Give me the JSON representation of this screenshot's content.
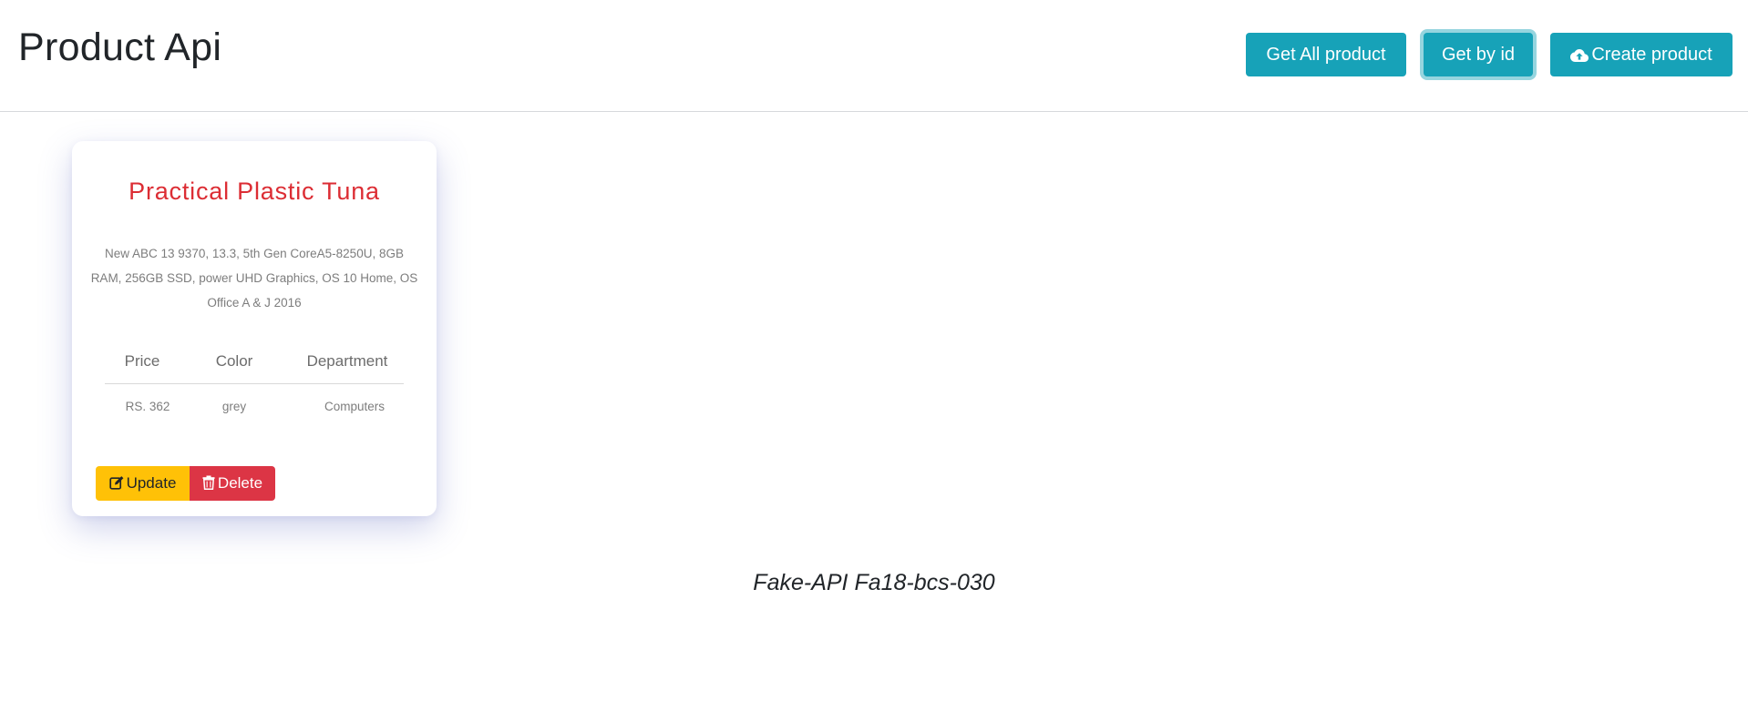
{
  "header": {
    "title": "Product Api",
    "buttons": {
      "get_all": "Get All product",
      "get_by_id": "Get by id",
      "create": "Create product"
    }
  },
  "product": {
    "name": "Practical Plastic Tuna",
    "description": "New ABC 13 9370, 13.3, 5th Gen CoreA5-8250U, 8GB RAM, 256GB SSD, power UHD Graphics, OS 10 Home, OS Office A & J 2016",
    "table": {
      "headers": [
        "Price",
        "Color",
        "Department"
      ],
      "values": [
        "RS. 362",
        "grey",
        "Computers"
      ]
    },
    "actions": {
      "update": "Update",
      "delete": "Delete"
    }
  },
  "footer": {
    "text": "Fake-API Fa18-bcs-030"
  },
  "icons": {
    "create": "cloud-upload-icon",
    "update": "edit-icon",
    "delete": "trash-icon"
  },
  "colors": {
    "primary_button": "#17a2b8",
    "warning_button": "#ffc107",
    "danger_button": "#dc3545",
    "product_name": "#dc2d34"
  }
}
